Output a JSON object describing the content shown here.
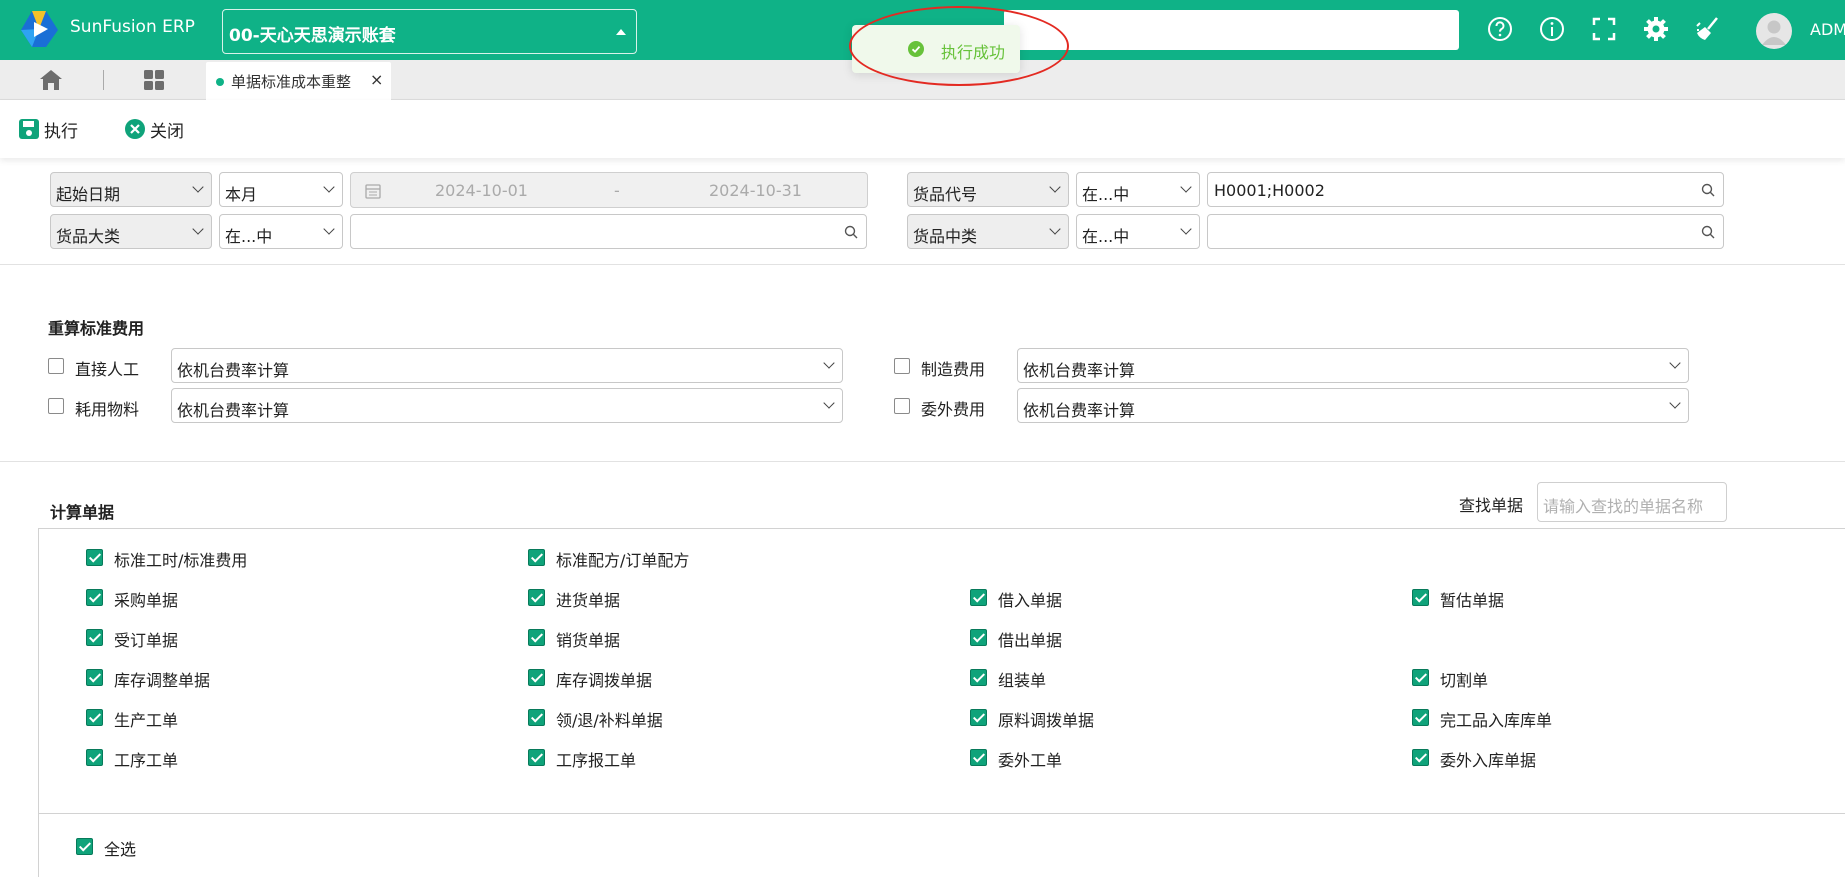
{
  "app": {
    "brand": "SunFusion ERP",
    "account_selector": "00-天心天思演示账套",
    "username": "ADM",
    "top_icons": [
      "help-icon",
      "info-icon",
      "fullscreen-icon",
      "settings-icon",
      "broom-icon"
    ]
  },
  "toast": {
    "message": "执行成功"
  },
  "tabs": {
    "active_tab": "单据标准成本重整"
  },
  "toolbar": {
    "execute_label": "执行",
    "close_label": "关闭"
  },
  "filters": {
    "row1_left": {
      "field": "起始日期",
      "operator": "本月",
      "date_from": "2024-10-01",
      "date_sep": "-",
      "date_to": "2024-10-31"
    },
    "row1_right": {
      "field": "货品代号",
      "operator": "在...中",
      "value": "H0001;H0002"
    },
    "row2_left": {
      "field": "货品大类",
      "operator": "在...中",
      "value": ""
    },
    "row2_right": {
      "field": "货品中类",
      "operator": "在...中",
      "value": ""
    }
  },
  "recalc": {
    "title": "重算标准费用",
    "items": [
      {
        "label": "直接人工",
        "checked": false,
        "method": "依机台费率计算"
      },
      {
        "label": "制造费用",
        "checked": false,
        "method": "依机台费率计算"
      },
      {
        "label": "耗用物料",
        "checked": false,
        "method": "依机台费率计算"
      },
      {
        "label": "委外费用",
        "checked": false,
        "method": "依机台费率计算"
      }
    ]
  },
  "documents": {
    "title": "计算单据",
    "search_label": "查找单据",
    "search_placeholder": "请输入查找的单据名称",
    "rows": [
      [
        "标准工时/标准费用",
        "标准配方/订单配方"
      ],
      [
        "采购单据",
        "进货单据",
        "借入单据",
        "暂估单据"
      ],
      [
        "受订单据",
        "销货单据",
        "借出单据"
      ],
      [
        "库存调整单据",
        "库存调拨单据",
        "组装单",
        "切割单"
      ],
      [
        "生产工单",
        "领/退/补料单据",
        "原料调拨单据",
        "完工品入库库单"
      ],
      [
        "工序工单",
        "工序报工单",
        "委外工单",
        "委外入库单据"
      ]
    ],
    "select_all_label": "全选"
  }
}
